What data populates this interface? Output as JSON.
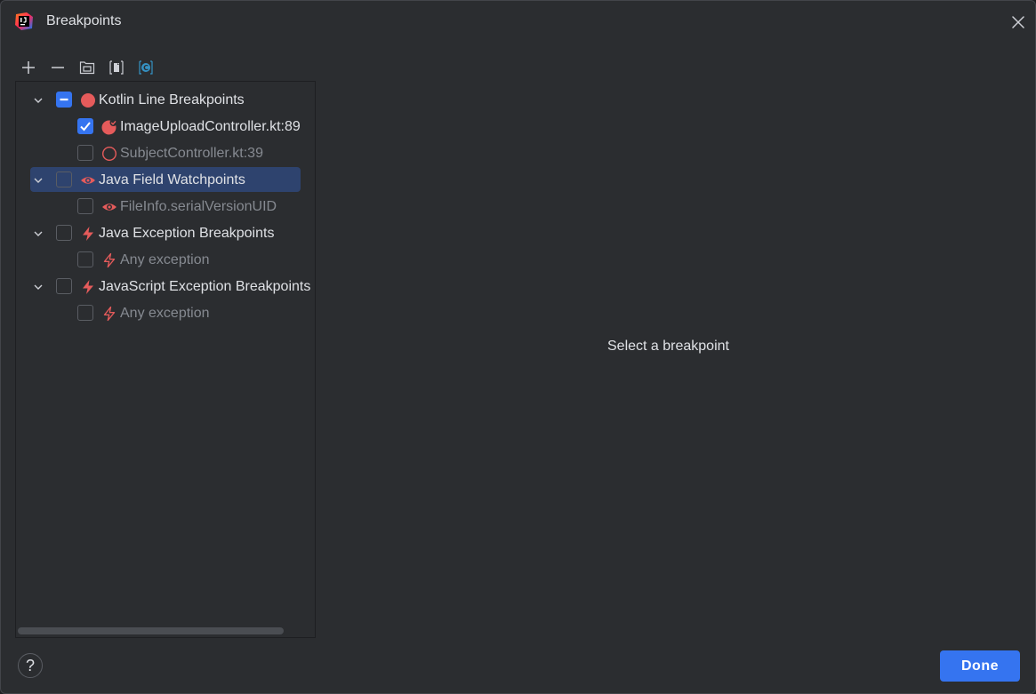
{
  "window": {
    "title": "Breakpoints",
    "app_icon": "intellij-idea-icon",
    "close_icon": "close-icon"
  },
  "toolbar": {
    "buttons": [
      {
        "name": "add-breakpoint-button",
        "icon": "plus-icon"
      },
      {
        "name": "remove-breakpoint-button",
        "icon": "minus-icon"
      },
      {
        "name": "group-by-package-button",
        "icon": "package-group-icon"
      },
      {
        "name": "group-by-file-button",
        "icon": "file-group-icon"
      },
      {
        "name": "group-by-class-button",
        "icon": "class-group-icon"
      }
    ]
  },
  "tree": {
    "groups": [
      {
        "label": "Kotlin Line Breakpoints",
        "state": "partial",
        "expanded": true,
        "icon": "red-breakpoint-dot-icon",
        "items": [
          {
            "label": "ImageUploadController.kt:89",
            "checked": true,
            "icon": "verified-breakpoint-icon"
          },
          {
            "label": "SubjectController.kt:39",
            "checked": false,
            "icon": "disabled-breakpoint-ring-icon"
          }
        ]
      },
      {
        "label": "Java Field Watchpoints",
        "state": "unchecked",
        "expanded": true,
        "selected": true,
        "icon": "watchpoint-eye-icon",
        "items": [
          {
            "label": "FileInfo.serialVersionUID",
            "checked": false,
            "icon": "watchpoint-eye-icon"
          }
        ]
      },
      {
        "label": "Java Exception Breakpoints",
        "state": "unchecked",
        "expanded": true,
        "icon": "exception-bolt-icon",
        "items": [
          {
            "label": "Any exception",
            "checked": false,
            "icon": "exception-bolt-outline-icon"
          }
        ]
      },
      {
        "label": "JavaScript Exception Breakpoints",
        "state": "unchecked",
        "expanded": true,
        "icon": "exception-bolt-icon",
        "items": [
          {
            "label": "Any exception",
            "checked": false,
            "icon": "exception-bolt-outline-icon"
          }
        ]
      }
    ]
  },
  "detail": {
    "placeholder": "Select a breakpoint"
  },
  "footer": {
    "help_label": "?",
    "done_label": "Done"
  },
  "colors": {
    "background": "#2b2d30",
    "accent": "#3574f0",
    "selection": "#2e436e",
    "breakpoint_red": "#e55b5b",
    "text": "#dfe1e5",
    "text_dim": "#868a91"
  }
}
